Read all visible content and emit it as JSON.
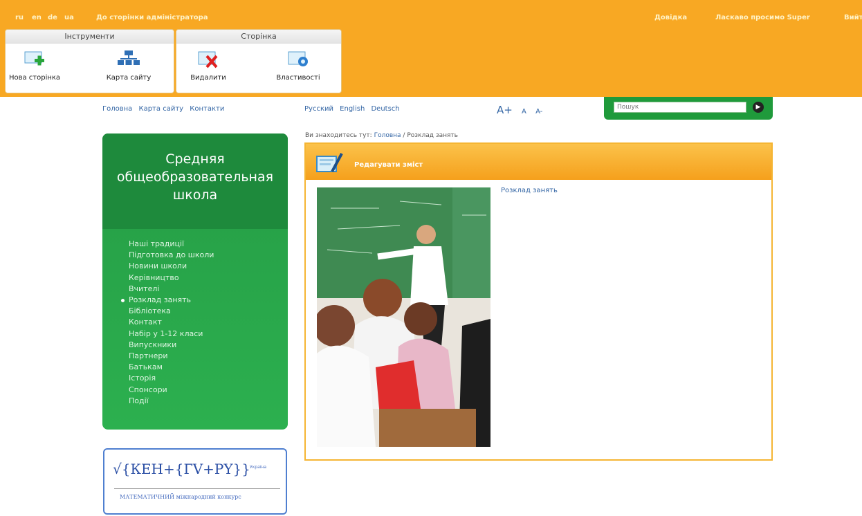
{
  "admin": {
    "langs": [
      "ru",
      "en",
      "de",
      "ua"
    ],
    "admin_link": "До сторінки адміністратора",
    "help": "Довідка",
    "welcome": "Ласкаво просимо Super",
    "logout": "Вийти",
    "panels": {
      "tools_title": "Інструменти",
      "page_title": "Сторінка",
      "new_page": "Нова сторінка",
      "sitemap": "Карта сайту",
      "delete": "Видалити",
      "properties": "Властивості"
    }
  },
  "nav": {
    "links": [
      "Головна",
      "Карта сайту",
      "Контакти"
    ],
    "languages": [
      "Русский",
      "English",
      "Deutsch"
    ],
    "font_sizes": [
      "A+",
      "A",
      "A-"
    ],
    "search_placeholder": "Пошук"
  },
  "sidebar": {
    "title_line1": "Средняя",
    "title_line2": "общеобразовательная",
    "title_line3": "школа",
    "items": [
      "Наші традиції",
      "Підготовка до школи",
      "Новини школи",
      "Керівництво",
      "Вчителі",
      "Розклад занять",
      "Бібліотека",
      "Контакт",
      "Набір у 1-12 класи",
      "Випускники",
      "Партнери",
      "Батькам",
      "Історія",
      "Спонсори",
      "Події"
    ],
    "active_index": 5
  },
  "banner": {
    "formula": "√{КЕН+{ГV+РY}}",
    "tag": "Україна",
    "caption": "МАТЕМАТИЧНИЙ міжнародний конкурс"
  },
  "main": {
    "breadcrumb_prefix": "Ви знаходитесь тут: ",
    "breadcrumb_home": "Головна",
    "breadcrumb_sep": " / ",
    "breadcrumb_current": "Розклад занять",
    "edit_label": "Редагувати зміст",
    "content_link": "Розклад занять"
  },
  "colors": {
    "admin_bar": "#f8a823",
    "sidebar_green": "#27a248",
    "link_blue": "#3466a5",
    "content_border": "#f5b533"
  }
}
